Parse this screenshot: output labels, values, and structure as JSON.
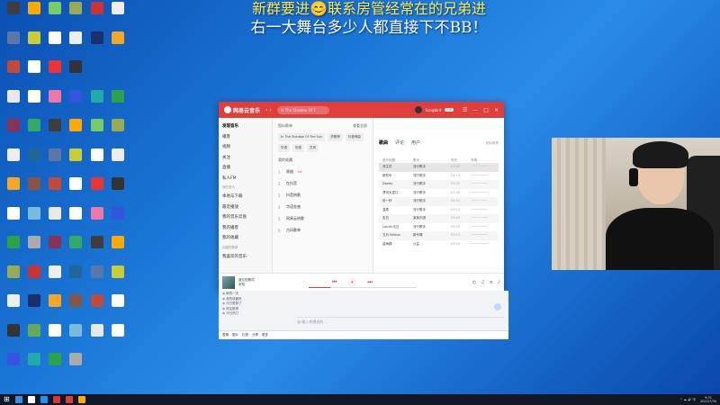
{
  "banner": {
    "line1": "新群要进😊联系房管经常在的兄弟进",
    "line2": "右一大舞台多少人都直接下不BB！"
  },
  "desktop_icons": [
    {
      "color": "#3d3d3d"
    },
    {
      "color": "#5a77a8"
    },
    {
      "color": "#c24a3a"
    },
    {
      "color": "#e9e9e9"
    },
    {
      "color": "#835"
    },
    {
      "color": "#eee"
    },
    {
      "color": "#f5a623"
    },
    {
      "color": "#fff"
    },
    {
      "color": "#2ca34a"
    },
    {
      "color": "#9a5"
    },
    {
      "color": "#eee"
    },
    {
      "color": "#333"
    },
    {
      "color": "#35d"
    },
    {
      "color": "#fa0"
    },
    {
      "color": "#cc3"
    },
    {
      "color": "#fff"
    },
    {
      "color": "#fff"
    },
    {
      "color": "#3a6"
    },
    {
      "color": "#269"
    },
    {
      "color": "#854"
    },
    {
      "color": "#7bd"
    },
    {
      "color": "#aaa"
    },
    {
      "color": "#c33"
    },
    {
      "color": "#1a2f6b"
    },
    {
      "color": "#6a5"
    },
    {
      "color": "#2aa"
    },
    {
      "color": "#7c6"
    },
    {
      "color": "#fff"
    },
    {
      "color": "#e33"
    },
    {
      "color": "#e7a"
    }
  ],
  "music": {
    "logo": "网易云音乐",
    "search_text": "In The Shadow Of T",
    "username": "Songbird",
    "vip": "VIP",
    "nav_arrows": "‹ ›",
    "window_controls": [
      "☰",
      "—",
      "□",
      "×"
    ],
    "sidebar": {
      "items": [
        "发现音乐",
        "播客",
        "视频",
        "关注",
        "直播",
        "私人FM"
      ],
      "section": "我的音乐",
      "items2": [
        "本地与下载",
        "最近播放",
        "我的音乐云盘",
        "我的播客",
        "我的收藏"
      ],
      "section2": "创建的歌单",
      "items3": [
        "我喜欢的音乐"
      ]
    },
    "list": {
      "title": "相似歌单",
      "more": "查看全部",
      "tags": [
        "In The Shadow Of The Sun",
        "热歌榜",
        "抖音神曲",
        "华语",
        "伤感",
        "古风"
      ],
      "sub": "我的收藏",
      "rows": [
        {
          "n": "1",
          "name": "原曲",
          "badge": "MV"
        },
        {
          "n": "2",
          "name": "在抖音"
        },
        {
          "n": "3",
          "name": "抖音热歌"
        },
        {
          "n": "4",
          "name": "华语金曲"
        },
        {
          "n": "5",
          "name": "网易云热歌"
        },
        {
          "n": "6",
          "name": "古风歌单"
        }
      ]
    },
    "main": {
      "tabs": [
        "歌曲",
        "评论",
        "用户"
      ],
      "meta": "相似推荐",
      "cols": [
        "音乐标题",
        "歌手",
        "时长",
        "专辑"
      ],
      "rows": [
        {
          "title": "双生花",
          "artist": "流行歌手",
          "dur": "03:45",
          "album": "••••••••••••"
        },
        {
          "title": "那些年",
          "artist": "流行歌手",
          "dur": "04:10",
          "album": "••••••••••••"
        },
        {
          "title": "Dandy",
          "artist": "流行歌手",
          "dur": "03:30",
          "album": "••••••••••••"
        },
        {
          "title": "漂流天涯口",
          "artist": "流行歌手",
          "dur": "03:58",
          "album": "••••••••••••"
        },
        {
          "title": "前一秒",
          "artist": "流行歌手",
          "dur": "04:02",
          "album": "••••••••••••"
        },
        {
          "title": "温柔",
          "artist": "流行歌手",
          "dur": "03:21",
          "album": "••••••••••••"
        },
        {
          "title": "告白",
          "artist": "某某乐团",
          "dur": "03:49",
          "album": "••••••••••••"
        },
        {
          "title": "Lanzhi元旦",
          "artist": "流行歌手",
          "dur": "03:33",
          "album": "••••••••••••"
        },
        {
          "title": "五月 Nilious",
          "artist": "新专辑",
          "dur": "03:15",
          "album": "••••••••••••"
        },
        {
          "title": "曲海娜",
          "artist": "公益",
          "dur": "03:40",
          "album": "••••••••••••"
        }
      ]
    },
    "player": {
      "now": "遗忘的歌词",
      "artist": "未知",
      "progress": 0.2,
      "prev": "⏮",
      "play": "⏸",
      "next": "⏭",
      "extras": [
        "◴",
        "♫",
        "≡",
        "♪"
      ]
    }
  },
  "chat": {
    "items": [
      "新的一天",
      "我的收藏夹",
      "今日更新了",
      "好友推荐",
      "今日热门"
    ],
    "input_placeholder": "@ 输入你想说的...",
    "toolbar": [
      "表情",
      "图片",
      "礼物",
      "分享",
      "更多"
    ]
  },
  "taskbar": {
    "start": "⊞",
    "apps": [
      {
        "color": "#3a8ee6"
      },
      {
        "color": "#fff"
      },
      {
        "color": "#1e90ff"
      },
      {
        "color": "#d33"
      },
      {
        "color": "#e13d3b"
      },
      {
        "color": "#fa0"
      }
    ],
    "tray": "^ ☁ 🔊 中",
    "time": "9:31",
    "date": "2022/7/30"
  }
}
